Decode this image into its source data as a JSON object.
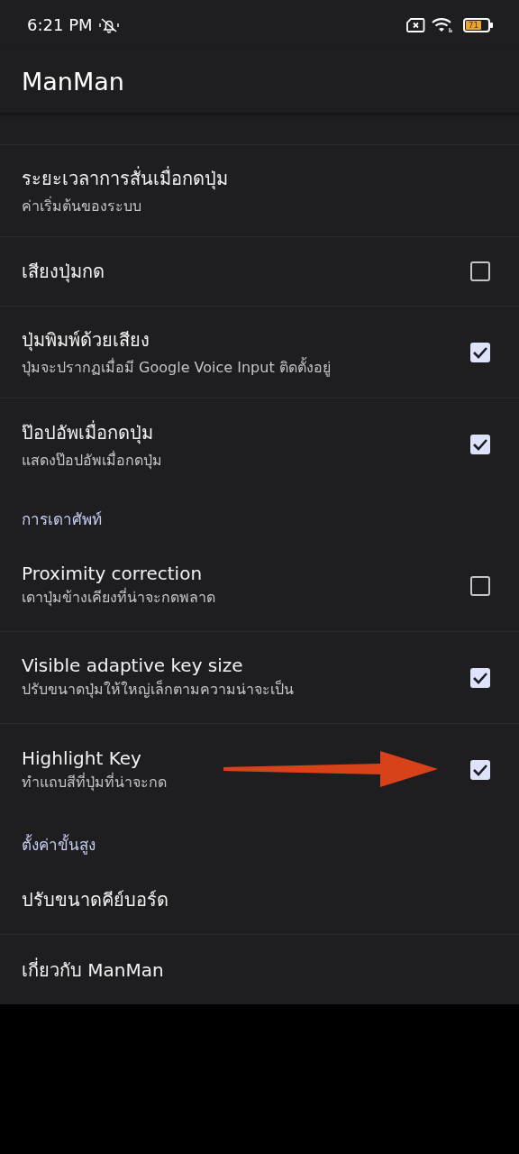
{
  "status_bar": {
    "time": "6:21 PM",
    "battery": "71"
  },
  "app_bar": {
    "title": "ManMan"
  },
  "sections": [
    {
      "items": [
        {
          "kind": "text",
          "title": "ระยะเวลาการสั่นเมื่อกดปุ่ม",
          "summary": "ค่าเริ่มต้นของระบบ"
        },
        {
          "kind": "checkbox",
          "title": "เสียงปุ่มกด",
          "checked": false
        },
        {
          "kind": "checkbox",
          "title": "ปุ่มพิมพ์ด้วยเสียง",
          "summary": "ปุ่มจะปรากฏเมื่อมี Google Voice Input ติดตั้งอยู่",
          "checked": true
        },
        {
          "kind": "checkbox",
          "title": "ป๊อปอัพเมื่อกดปุ่ม",
          "summary": "แสดงป๊อปอัพเมื่อกดปุ่ม",
          "checked": true
        }
      ]
    },
    {
      "header": "การเดาศัพท์",
      "items": [
        {
          "kind": "checkbox",
          "title": "Proximity correction",
          "summary": "เดาปุ่มข้างเคียงที่น่าจะกดพลาด",
          "checked": false
        },
        {
          "kind": "checkbox",
          "title": "Visible adaptive key size",
          "summary": "ปรับขนาดปุ่มให้ใหญ่เล็กตามความน่าจะเป็น",
          "checked": true
        },
        {
          "kind": "checkbox",
          "title": "Highlight Key",
          "summary": "ทำแถบสีที่ปุ่มที่น่าจะกด",
          "checked": true,
          "pointed": true
        }
      ]
    },
    {
      "header": "ตั้งค่าขั้นสูง",
      "items": [
        {
          "kind": "text",
          "title": "ปรับขนาดคีย์บอร์ด"
        },
        {
          "kind": "text",
          "title": "เกี่ยวกับ ManMan"
        }
      ]
    }
  ]
}
